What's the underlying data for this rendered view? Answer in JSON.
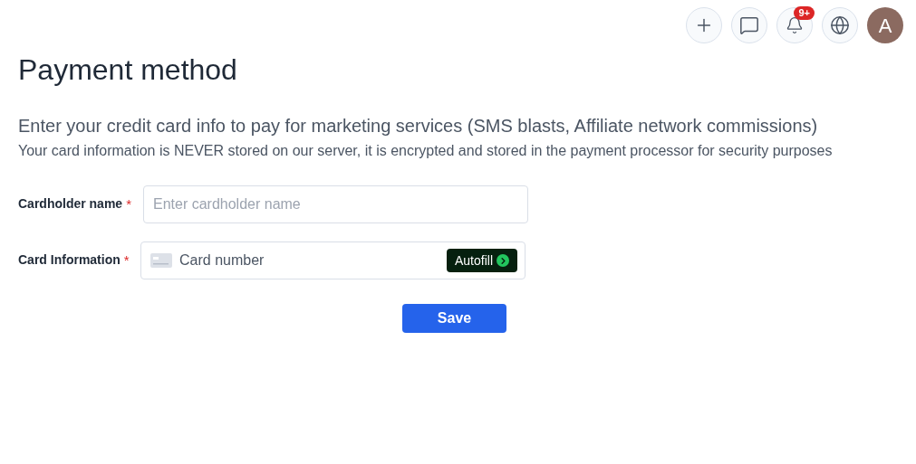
{
  "header": {
    "notification_badge": "9+",
    "avatar_initial": "A"
  },
  "title": "Payment method",
  "subtitle": "Enter your credit card info to pay for marketing services (SMS blasts, Affiliate network commissions)",
  "note": "Your card information is NEVER stored on our server, it is encrypted and stored in the payment processor for security purposes",
  "fields": [
    {
      "kind": "text",
      "label": "Cardholder name",
      "required_mark": "*",
      "placeholder": "Enter cardholder name"
    },
    {
      "kind": "card",
      "label": "Card Information",
      "required_mark": "*",
      "placeholder": "Card number",
      "autofill": "Autofill"
    }
  ],
  "save_button": "Save"
}
